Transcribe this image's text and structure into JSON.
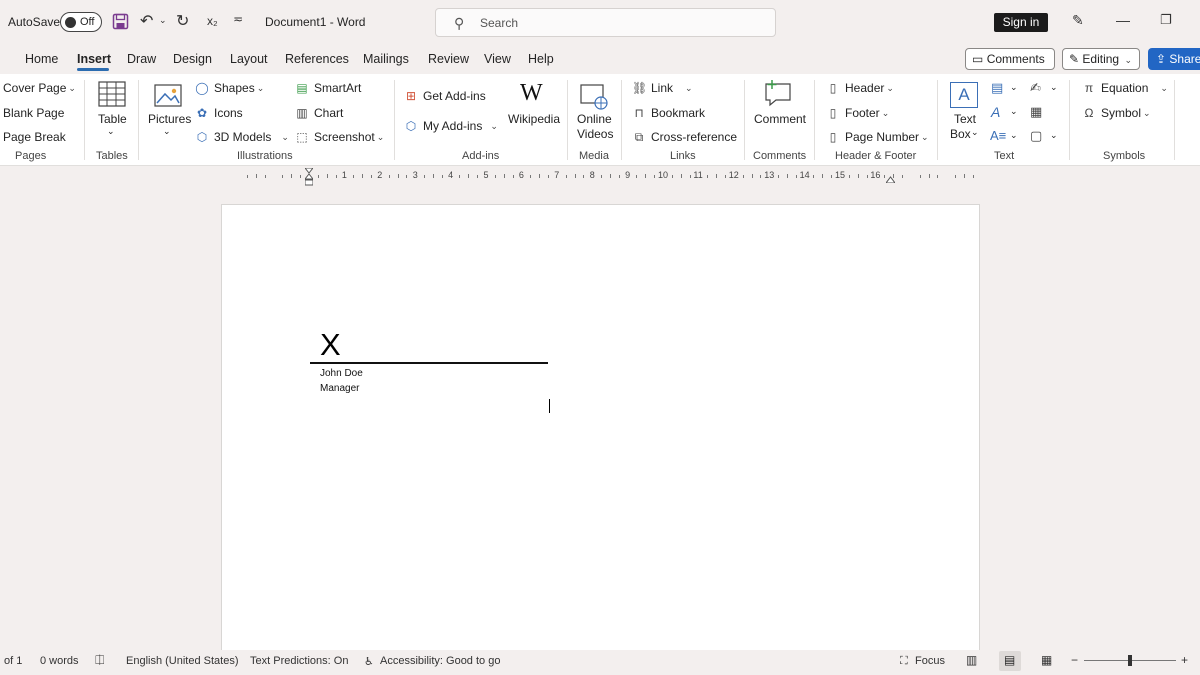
{
  "titlebar": {
    "autosave_label": "AutoSave",
    "autosave_state": "Off",
    "subscript_label": "x₂",
    "doc_title": "Document1  -  Word",
    "search_placeholder": "Search",
    "signin_label": "Sign in"
  },
  "tabs": [
    "Home",
    "Insert",
    "Draw",
    "Design",
    "Layout",
    "References",
    "Mailings",
    "Review",
    "View",
    "Help"
  ],
  "active_tab": "Insert",
  "top_buttons": {
    "comments": "Comments",
    "editing": "Editing",
    "share": "Share"
  },
  "ribbon": {
    "pages": {
      "items": [
        "Cover Page",
        "Blank Page",
        "Page Break"
      ],
      "label": "Pages"
    },
    "tables": {
      "table": "Table",
      "label": "Tables"
    },
    "illustrations": {
      "pictures": "Pictures",
      "shapes": "Shapes",
      "icons": "Icons",
      "models": "3D Models",
      "smartart": "SmartArt",
      "chart": "Chart",
      "screenshot": "Screenshot",
      "label": "Illustrations"
    },
    "addins": {
      "get": "Get Add-ins",
      "my": "My Add-ins",
      "wikipedia": "Wikipedia",
      "wiki_glyph": "W",
      "label": "Add-ins"
    },
    "media": {
      "online_videos_1": "Online",
      "online_videos_2": "Videos",
      "label": "Media"
    },
    "links": {
      "link": "Link",
      "bookmark": "Bookmark",
      "crossref": "Cross-reference",
      "label": "Links"
    },
    "comments": {
      "comment": "Comment",
      "label": "Comments"
    },
    "header_footer": {
      "header": "Header",
      "footer": "Footer",
      "page_number": "Page Number",
      "label": "Header & Footer"
    },
    "text": {
      "textbox_1": "Text",
      "textbox_2": "Box",
      "textbox_glyph": "A",
      "label": "Text"
    },
    "symbols": {
      "equation": "Equation",
      "symbol": "Symbol",
      "label": "Symbols"
    }
  },
  "ruler": {
    "numbers": [
      "1",
      "2",
      "3",
      "4",
      "5",
      "6",
      "7",
      "8",
      "9",
      "10",
      "11",
      "12",
      "13",
      "14",
      "15",
      "16"
    ]
  },
  "document": {
    "signature_x": "X",
    "signer_name": "John Doe",
    "signer_title": "Manager"
  },
  "status": {
    "page": "of 1",
    "words": "0 words",
    "language": "English (United States)",
    "predictions": "Text Predictions: On",
    "accessibility": "Accessibility: Good to go",
    "focus": "Focus"
  }
}
